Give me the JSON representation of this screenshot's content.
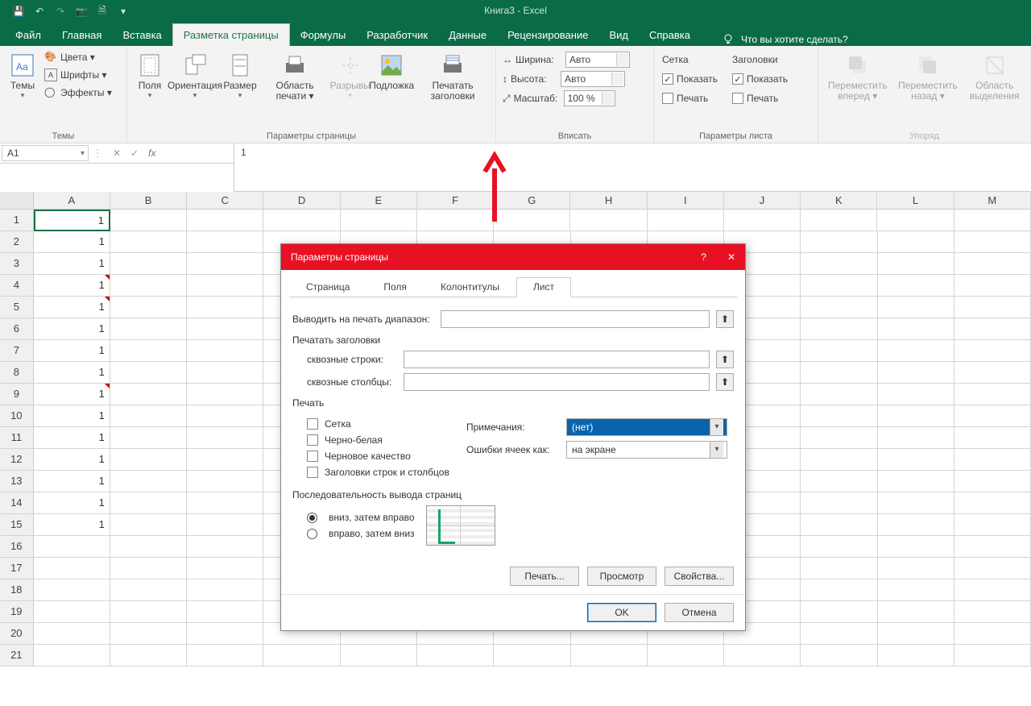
{
  "window": {
    "title": "Книга3  -  Excel"
  },
  "qat": {
    "save": "💾",
    "undo": "↶",
    "redo": "↷",
    "camera": "📷",
    "preview": "🗎"
  },
  "tabs": {
    "file": "Файл",
    "home": "Главная",
    "insert": "Вставка",
    "layout": "Разметка страницы",
    "formulas": "Формулы",
    "developer": "Разработчик",
    "data": "Данные",
    "review": "Рецензирование",
    "view": "Вид",
    "help": "Справка",
    "tellme": "Что вы хотите сделать?"
  },
  "ribbon": {
    "themes": {
      "group": "Темы",
      "themes": "Темы",
      "colors": "Цвета ▾",
      "fonts": "Шрифты ▾",
      "effects": "Эффекты ▾"
    },
    "pageSetup": {
      "group": "Параметры страницы",
      "margins": "Поля",
      "orientation": "Ориентация",
      "size": "Размер",
      "printArea": "Область печати ▾",
      "breaks": "Разрывы",
      "background": "Подложка",
      "printTitles": "Печатать заголовки"
    },
    "fit": {
      "group": "Вписать",
      "widthL": "Ширина:",
      "width": "Авто",
      "heightL": "Высота:",
      "height": "Авто",
      "scaleL": "Масштаб:",
      "scale": "100 %"
    },
    "sheet": {
      "group": "Параметры листа",
      "grid": "Сетка",
      "headings": "Заголовки",
      "show": "Показать",
      "print": "Печать"
    },
    "arrange": {
      "group": "Упоряд",
      "forward": "Переместить вперед ▾",
      "backward": "Переместить назад ▾",
      "selection": "Область выделения"
    }
  },
  "nameBox": "A1",
  "formula": "1",
  "columns": [
    "A",
    "B",
    "C",
    "D",
    "E",
    "F",
    "G",
    "H",
    "I",
    "J",
    "K",
    "L",
    "M"
  ],
  "rows": [
    1,
    2,
    3,
    4,
    5,
    6,
    7,
    8,
    9,
    10,
    11,
    12,
    13,
    14,
    15,
    16,
    17,
    18,
    19,
    20,
    21
  ],
  "cells": {
    "A": [
      "1",
      "1",
      "1",
      "1",
      "1",
      "1",
      "1",
      "1",
      "1",
      "1",
      "1",
      "1",
      "1",
      "1",
      "1",
      "",
      "",
      "",
      "",
      "",
      ""
    ]
  },
  "redTriRows": [
    4,
    5,
    9
  ],
  "dialog": {
    "title": "Параметры страницы",
    "help": "?",
    "close": "✕",
    "tabs": {
      "page": "Страница",
      "margins": "Поля",
      "hf": "Колонтитулы",
      "sheet": "Лист"
    },
    "printRange": "Выводить на печать диапазон:",
    "printTitlesSect": "Печатать заголовки",
    "rowsRepeat": "сквозные строки:",
    "colsRepeat": "сквозные столбцы:",
    "printSect": "Печать",
    "gridlines": "Сетка",
    "bw": "Черно-белая",
    "draft": "Черновое качество",
    "rcHead": "Заголовки строк и столбцов",
    "commentsL": "Примечания:",
    "comments": "(нет)",
    "errorsL": "Ошибки ячеек как:",
    "errors": "на экране",
    "orderSect": "Последовательность вывода страниц",
    "downOver": "вниз, затем вправо",
    "overDown": "вправо, затем вниз",
    "printBtn": "Печать...",
    "previewBtn": "Просмотр",
    "propsBtn": "Свойства...",
    "ok": "OK",
    "cancel": "Отмена"
  }
}
